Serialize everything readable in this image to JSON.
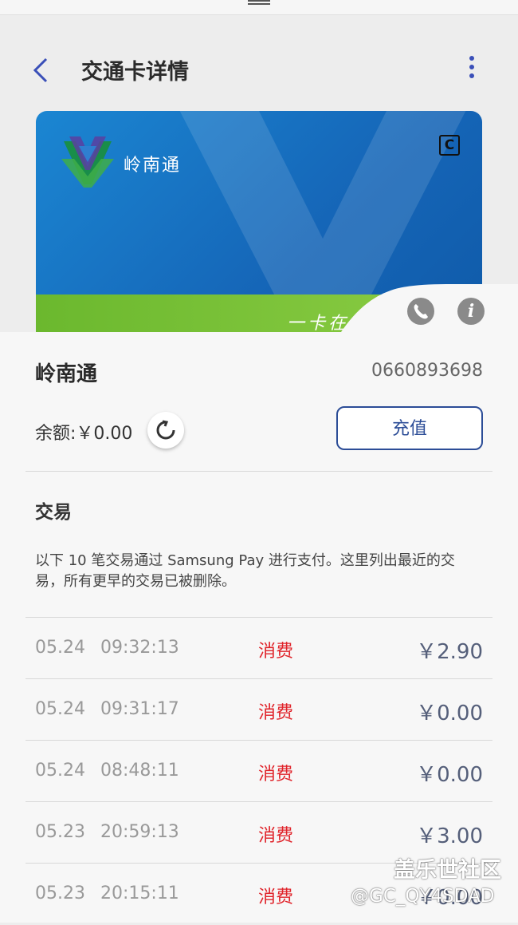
{
  "header": {
    "title": "交通卡详情"
  },
  "card": {
    "brand": "岭南通",
    "slogan": "一卡在手",
    "badge": "C"
  },
  "summary": {
    "name": "岭南通",
    "number": "0660893698",
    "balance": "余额:￥0.00",
    "topup_label": "充值"
  },
  "transactions_section": {
    "title": "交易",
    "description": "以下 10 笔交易通过 Samsung Pay 进行支付。这里列出最近的交易，所有更早的交易已被删除。"
  },
  "transactions": [
    {
      "date": "05.24",
      "time": "09:32:13",
      "type": "消费",
      "amount": "￥2.90"
    },
    {
      "date": "05.24",
      "time": "09:31:17",
      "type": "消费",
      "amount": "￥0.00"
    },
    {
      "date": "05.24",
      "time": "08:48:11",
      "type": "消费",
      "amount": "￥0.00"
    },
    {
      "date": "05.23",
      "time": "20:59:13",
      "type": "消费",
      "amount": "￥3.00"
    },
    {
      "date": "05.23",
      "time": "20:15:11",
      "type": "消费",
      "amount": "￥0.00"
    }
  ],
  "watermark": {
    "line1": "盖乐世社区",
    "line2": "@GC_QY4SDAD"
  },
  "icons": [
    "back-arrow-icon",
    "more-vertical-icon",
    "phone-icon",
    "info-icon",
    "refresh-icon",
    "lingnantong-logo-icon"
  ],
  "colors": {
    "accent": "#2c4d97",
    "expense_red": "#e0232a",
    "card_blue": "#1565b7",
    "card_green": "#7bc23a"
  }
}
